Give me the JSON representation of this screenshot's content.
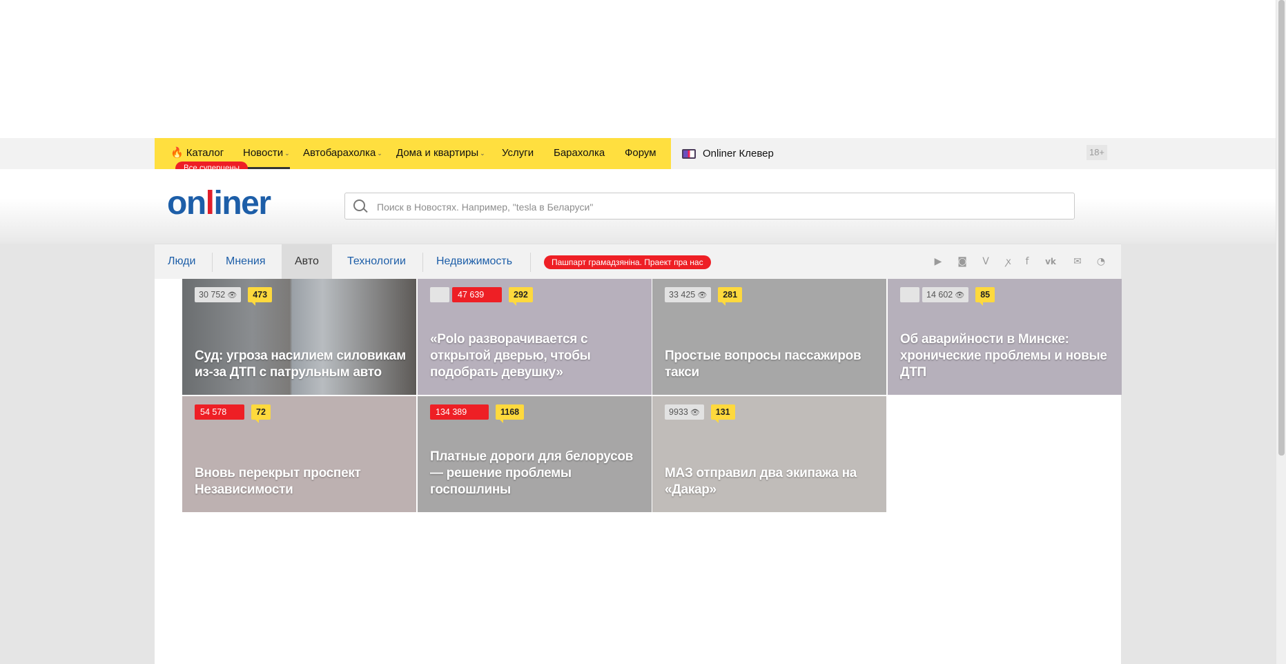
{
  "topnav": {
    "items": [
      {
        "label": "Каталог"
      },
      {
        "label": "Новости"
      },
      {
        "label": "Автобарахолка"
      },
      {
        "label": "Дома и квартиры"
      },
      {
        "label": "Услуги"
      },
      {
        "label": "Барахолка"
      },
      {
        "label": "Форум"
      }
    ],
    "superprice_badge": "Все суперцены",
    "clever": "Onliner Клевер",
    "age": "18+",
    "accent_color": "#ffdf3f"
  },
  "logo": {
    "text_a": "on",
    "text_b": "l",
    "text_c": "iner",
    "color": "#1d5ea8",
    "accent": "#e11e2a"
  },
  "search": {
    "placeholder": "Поиск в Новостях. Например, \"tesla в Беларуси\""
  },
  "tabs": {
    "items": [
      {
        "label": "Люди"
      },
      {
        "label": "Мнения"
      },
      {
        "label": "Авто"
      },
      {
        "label": "Технологии"
      },
      {
        "label": "Недвижимость"
      }
    ],
    "active": "Авто",
    "promo": "Пашпарт грамадзяніна. Праект пра нас"
  },
  "social_icons": [
    "youtube-icon",
    "instagram-icon",
    "twitter-icon",
    "odnoklassniki-icon",
    "facebook-icon",
    "vk-icon",
    "mail-icon",
    "rss-icon"
  ],
  "news": [
    {
      "title": "Суд: угроза насилием силовикам из-за ДТП с патрульным авто",
      "views": "30 752",
      "comments": "473",
      "views_style": "gray"
    },
    {
      "title": "«Polo разворачивается с открытой дверью, чтобы подобрать девушку»",
      "views": "47 639",
      "comments": "292",
      "views_style": "red"
    },
    {
      "title": "Простые вопросы пассажиров такси",
      "views": "33 425",
      "comments": "281",
      "views_style": "gray"
    },
    {
      "title": "Об аварийности в Минске: хронические проблемы и новые ДТП",
      "views": "14 602",
      "comments": "85",
      "views_style": "gray"
    },
    {
      "title": "Вновь перекрыт проспект Независимости",
      "views": "54 578",
      "comments": "72",
      "views_style": "red"
    },
    {
      "title": "Платные дороги для белорусов — решение проблемы госпошлины",
      "views": "134 389",
      "comments": "1168",
      "views_style": "red"
    },
    {
      "title": "МАЗ отправил два экипажа на «Дакар»",
      "views": "9933",
      "comments": "131",
      "views_style": "gray"
    }
  ]
}
